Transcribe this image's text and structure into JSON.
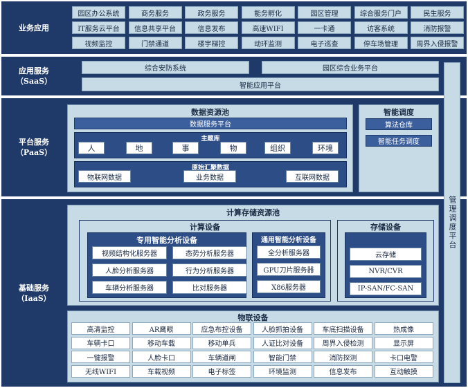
{
  "layers": {
    "business": {
      "label": "业务应用",
      "items": [
        [
          "园区办公系统",
          "商务服务",
          "政务服务",
          "能务孵化",
          "园区管理",
          "综合服务门户",
          "民生服务"
        ],
        [
          "IT服务云平台",
          "信息共享平台",
          "信息发布",
          "高速WIFI",
          "一卡通",
          "访客系统",
          "消防报警"
        ],
        [
          "视频监控",
          "门禁通道",
          "楼宇梯控",
          "动环监测",
          "电子巡查",
          "停车场管理",
          "周界入侵报警"
        ]
      ]
    },
    "saas": {
      "label": "应用服务",
      "sublabel": "（SaaS）",
      "items": [
        "综合安防系统",
        "园区综合业务平台",
        "智能应用平台"
      ]
    },
    "paas": {
      "label": "平台服务",
      "sublabel": "（PaaS）",
      "data_pool": {
        "title": "数据资源池",
        "service_platform": "数据服务平台",
        "topic_title": "主题库",
        "topics": [
          "人",
          "地",
          "事",
          "物",
          "组织",
          "环境"
        ],
        "raw_title": "原始汇聚数据",
        "raw": [
          "物联网数据",
          "业务数据",
          "互联网数据"
        ]
      },
      "scheduling": {
        "title": "智能调度",
        "items": [
          "算法仓库",
          "智能任务调度"
        ]
      }
    },
    "iaas": {
      "label": "基础服务",
      "sublabel": "（IaaS）",
      "compute_pool_title": "计算存储资源池",
      "compute": {
        "title": "计算设备",
        "special": {
          "title": "专用智能分析设备",
          "items": [
            "视频结构化服务器",
            "态势分析服务器",
            "人脸分析服务器",
            "行为分析服务器",
            "车辆分析服务器",
            "比对服务器"
          ]
        },
        "general": {
          "title": "通用智能分析设备",
          "items": [
            "全分析服务器",
            "GPU刀片服务器",
            "X86服务器"
          ]
        }
      },
      "storage": {
        "title": "存储设备",
        "items": [
          "云存储",
          "NVR/CVR",
          "IP-SAN/FC-SAN"
        ]
      },
      "iot": {
        "title": "物联设备",
        "items": [
          [
            "高清监控",
            "AR鹰眼",
            "应急布控设备",
            "人脸抓拍设备",
            "车底扫描设备",
            "热成像"
          ],
          [
            "车辆卡口",
            "移动车载",
            "移动单兵",
            "人证比对设备",
            "周界入侵检测",
            "显示屏"
          ],
          [
            "一键报警",
            "人脸卡口",
            "车辆道闸",
            "智能门禁",
            "消防探测",
            "卡口电警"
          ],
          [
            "无线WIFI",
            "车载视频",
            "电子标签",
            "环境监测",
            "信息发布",
            "互动触摸"
          ]
        ]
      }
    }
  },
  "side_platform": "管理调度平台"
}
